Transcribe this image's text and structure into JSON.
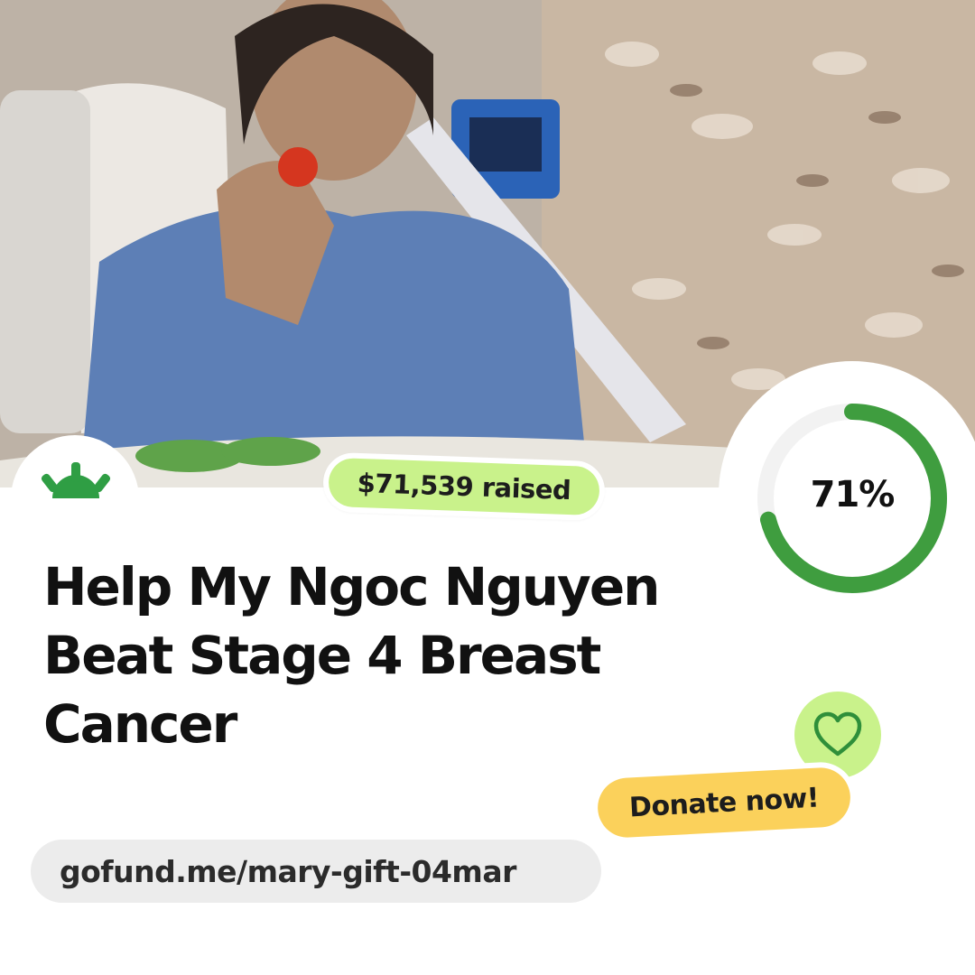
{
  "campaign": {
    "photo": {
      "icon": "patient-photo"
    },
    "logo": {
      "icon": "gofundme-sunrise-icon",
      "color": "#2f9e44"
    },
    "raised": {
      "label": "$71,539 raised",
      "color": "#c9f28b"
    },
    "progress": {
      "percent_label": "71%",
      "fraction": 0.71,
      "track_color": "#f2f2f2",
      "fill_color": "#3f9d3f"
    },
    "title": "Help My Ngoc Nguyen Beat Stage 4 Breast Cancer",
    "donate": {
      "label": "Donate now!",
      "color": "#fbd15b",
      "heart_icon": "heart-icon",
      "heart_color": "#2f8f3a",
      "heart_bg": "#c9f28b"
    },
    "url": "gofund.me/mary-gift-04mar"
  }
}
